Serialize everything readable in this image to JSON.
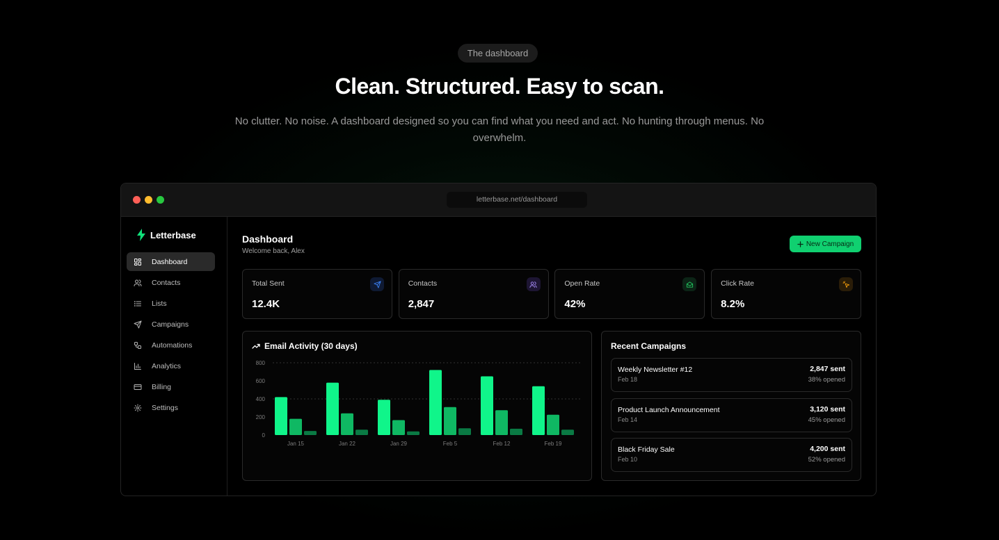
{
  "hero": {
    "pill": "The dashboard",
    "title": "Clean. Structured. Easy to scan.",
    "subtitle": "No clutter. No noise. A dashboard designed so you can find what you need and act. No hunting through menus. No overwhelm."
  },
  "window": {
    "url": "letterbase.net/dashboard",
    "traffic_lights": [
      "#ff5f57",
      "#febc2e",
      "#28c840"
    ]
  },
  "sidebar": {
    "brand": "Letterbase",
    "items": [
      {
        "label": "Dashboard",
        "icon": "grid-icon",
        "active": true
      },
      {
        "label": "Contacts",
        "icon": "users-icon",
        "active": false
      },
      {
        "label": "Lists",
        "icon": "list-icon",
        "active": false
      },
      {
        "label": "Campaigns",
        "icon": "send-icon",
        "active": false
      },
      {
        "label": "Automations",
        "icon": "workflow-icon",
        "active": false
      },
      {
        "label": "Analytics",
        "icon": "bar-chart-icon",
        "active": false
      },
      {
        "label": "Billing",
        "icon": "credit-card-icon",
        "active": false
      },
      {
        "label": "Settings",
        "icon": "gear-icon",
        "active": false
      }
    ]
  },
  "header": {
    "title": "Dashboard",
    "subtitle": "Welcome back, Alex",
    "new_campaign": "New Campaign"
  },
  "stats": [
    {
      "label": "Total Sent",
      "value": "12.4K",
      "icon": "send-icon",
      "color": "#3b82f6",
      "bg": "#0f1a33"
    },
    {
      "label": "Contacts",
      "value": "2,847",
      "icon": "users-icon",
      "color": "#a78bfa",
      "bg": "#1d1533"
    },
    {
      "label": "Open Rate",
      "value": "42%",
      "icon": "mail-open-icon",
      "color": "#22c55e",
      "bg": "#0c2416"
    },
    {
      "label": "Click Rate",
      "value": "8.2%",
      "icon": "click-icon",
      "color": "#f59e0b",
      "bg": "#2a1d08"
    }
  ],
  "activity": {
    "title": "Email Activity (30 days)"
  },
  "recent": {
    "title": "Recent Campaigns",
    "items": [
      {
        "name": "Weekly Newsletter #12",
        "date": "Feb 18",
        "sent": "2,847 sent",
        "opened": "38% opened"
      },
      {
        "name": "Product Launch Announcement",
        "date": "Feb 14",
        "sent": "3,120 sent",
        "opened": "45% opened"
      },
      {
        "name": "Black Friday Sale",
        "date": "Feb 10",
        "sent": "4,200 sent",
        "opened": "52% opened"
      }
    ]
  },
  "chart_data": {
    "type": "bar",
    "title": "Email Activity (30 days)",
    "categories": [
      "Jan 15",
      "Jan 22",
      "Jan 29",
      "Feb 5",
      "Feb 12",
      "Feb 19"
    ],
    "series": [
      {
        "values": [
          420,
          580,
          390,
          720,
          650,
          540
        ],
        "color": "#10f58a"
      },
      {
        "values": [
          180,
          240,
          165,
          310,
          275,
          225
        ],
        "color": "#0fb863"
      },
      {
        "values": [
          45,
          60,
          40,
          75,
          70,
          60
        ],
        "color": "#0a7a44"
      }
    ],
    "yticks": [
      0,
      200,
      400,
      600,
      800
    ],
    "ylim": [
      0,
      800
    ],
    "grid": true
  }
}
